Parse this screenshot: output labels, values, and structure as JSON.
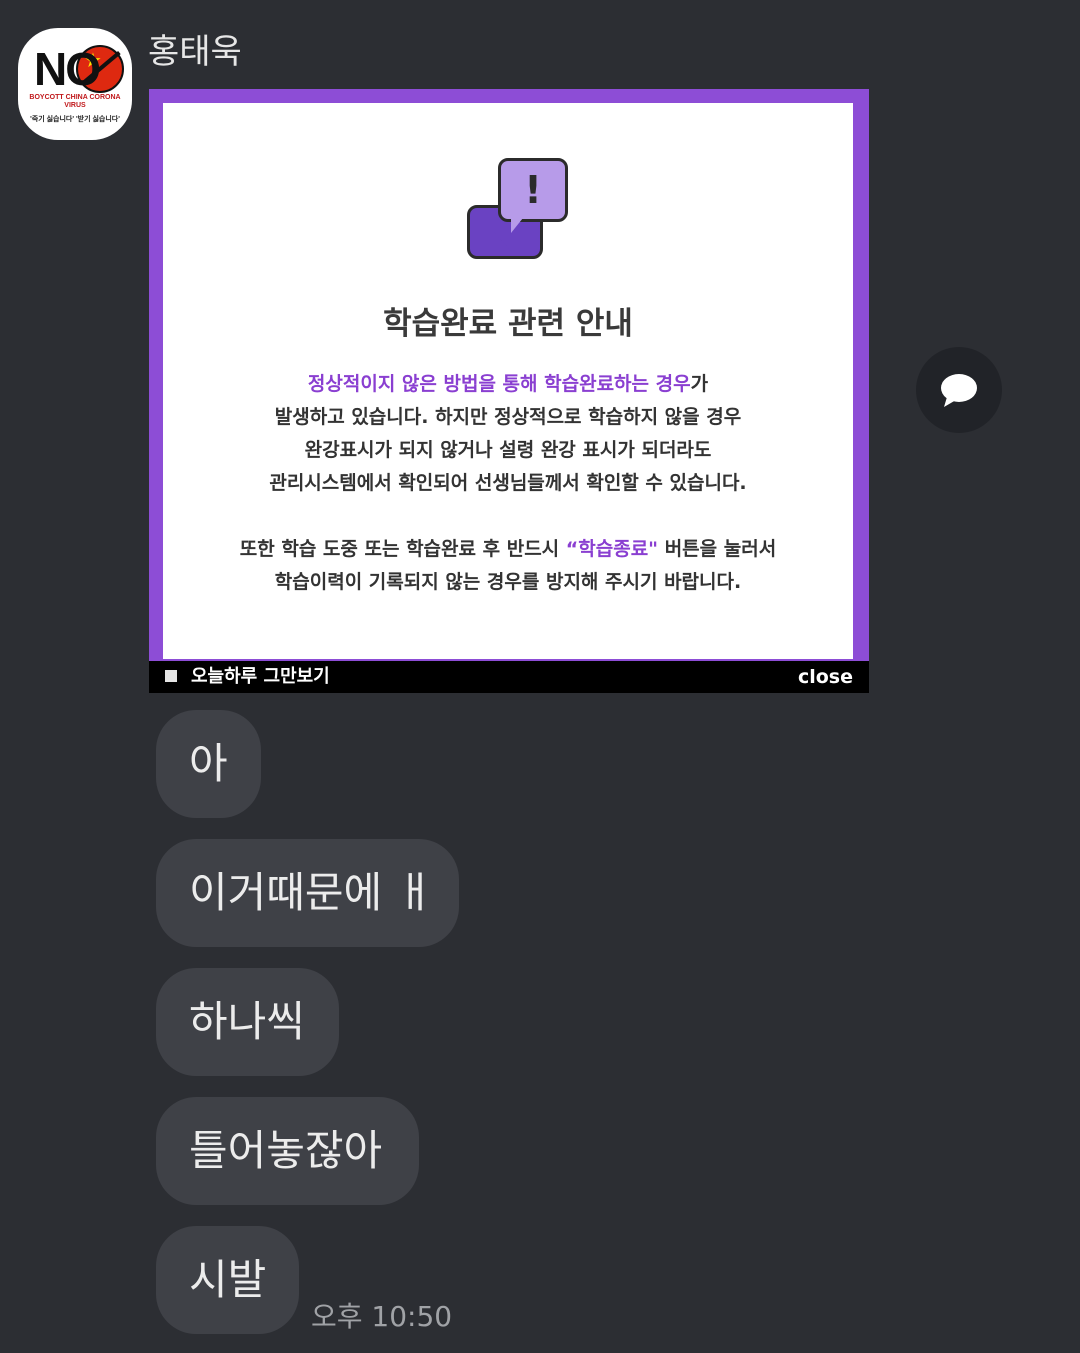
{
  "sender": {
    "name": "홍태욱",
    "avatar": {
      "main_text": "NO",
      "caption_red": "BOYCOTT CHINA CORONA VIRUS",
      "caption_black": "'죽기 싫습니다' '받기 싫습니다'"
    }
  },
  "popup": {
    "title": "학습완료 관련 안내",
    "para1": {
      "highlight": "정상적이지 않은 방법을 통해 학습완료하는 경우",
      "line1_rest": "가",
      "line2": "발생하고 있습니다. 하지만 정상적으로 학습하지 않을 경우",
      "line3": "완강표시가 되지 않거나 설령 완강 표시가 되더라도",
      "line4": "관리시스템에서 확인되어 선생님들께서 확인할 수 있습니다."
    },
    "para2": {
      "line1_start": "또한 학습 도중 또는 학습완료 후 반드시 ",
      "line1_highlight": "“학습종료\"",
      "line1_end": " 버튼을 눌러서",
      "line2": "학습이력이 기록되지 않는 경우를 방지해 주시기 바랍니다."
    },
    "checkbox_label": "오늘하루 그만보기",
    "close_label": "close",
    "accent_color": "#8d4dd6",
    "icon": "alert-chat-icon"
  },
  "share_button_icon": "chat-bubble-icon",
  "messages": [
    {
      "text": "아"
    },
    {
      "text": "이거때문에 ㅐ"
    },
    {
      "text": "하나씩"
    },
    {
      "text": "틀어놓잖아"
    },
    {
      "text": "시발"
    }
  ],
  "timestamp": "오후 10:50"
}
